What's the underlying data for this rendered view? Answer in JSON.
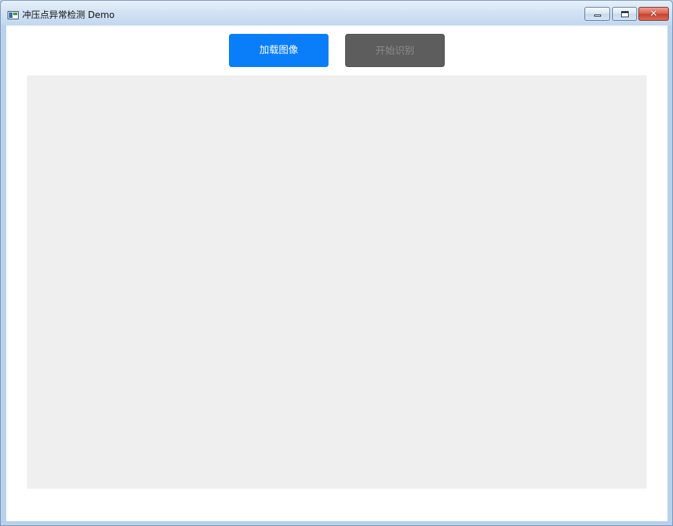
{
  "window": {
    "title": "冲压点异常检测 Demo",
    "close_glyph": "✕"
  },
  "toolbar": {
    "load_image_label": "加载图像",
    "start_recognition_label": "开始识别"
  },
  "colors": {
    "load_button": "#0a7ef9",
    "start_button_disabled": "#5d5d5d",
    "image_area": "#efefef"
  },
  "icons": {
    "app": "app-window-icon",
    "minimize": "minimize-icon",
    "maximize": "maximize-icon",
    "close": "close-icon"
  }
}
